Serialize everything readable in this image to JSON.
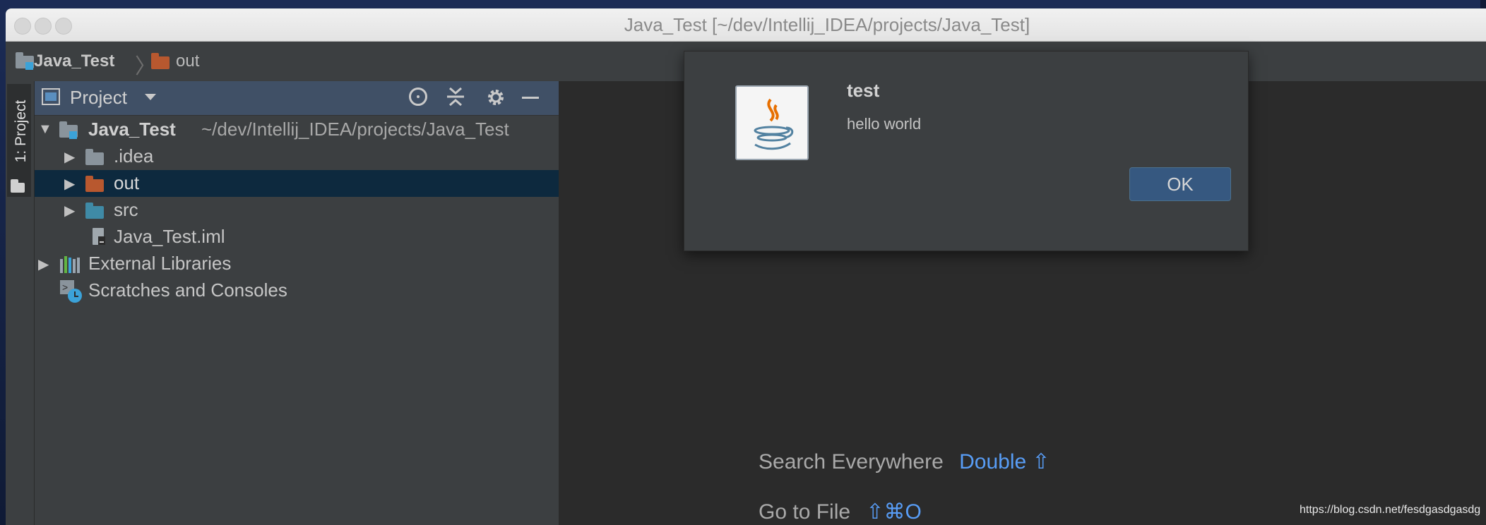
{
  "window": {
    "title": "Java_Test [~/dev/Intellij_IDEA/projects/Java_Test]"
  },
  "breadcrumb": {
    "project": "Java_Test",
    "separator": "〉",
    "folder": "out"
  },
  "tool_stripe": {
    "label": "1: Project"
  },
  "project_panel": {
    "view_label": "Project",
    "icons": [
      "locate-icon",
      "collapse-all-icon",
      "gear-icon",
      "minimize-icon"
    ],
    "tree": {
      "root": {
        "name": "Java_Test",
        "path": "~/dev/Intellij_IDEA/projects/Java_Test"
      },
      "items": [
        {
          "label": ".idea",
          "icon": "folder-icon"
        },
        {
          "label": "out",
          "icon": "excluded-folder-icon",
          "selected": true
        },
        {
          "label": "src",
          "icon": "source-folder-icon"
        },
        {
          "label": "Java_Test.iml",
          "icon": "module-file-icon"
        }
      ],
      "external_libraries": "External Libraries",
      "scratches": "Scratches and Consoles"
    }
  },
  "editor_hints": {
    "search_label": "Search Everywhere",
    "search_key": "Double ⇧",
    "goto_label": "Go to File",
    "goto_key": "⇧⌘O"
  },
  "dialog": {
    "title": "test",
    "message": "hello world",
    "ok_label": "OK"
  },
  "watermark": "https://blog.csdn.net/fesdgasdgasdg",
  "colors": {
    "accent_blue": "#589df6",
    "selection": "#0d293e",
    "excluded_folder": "#b8582f",
    "source_folder": "#3f8aa6",
    "ok_button": "#365880"
  }
}
